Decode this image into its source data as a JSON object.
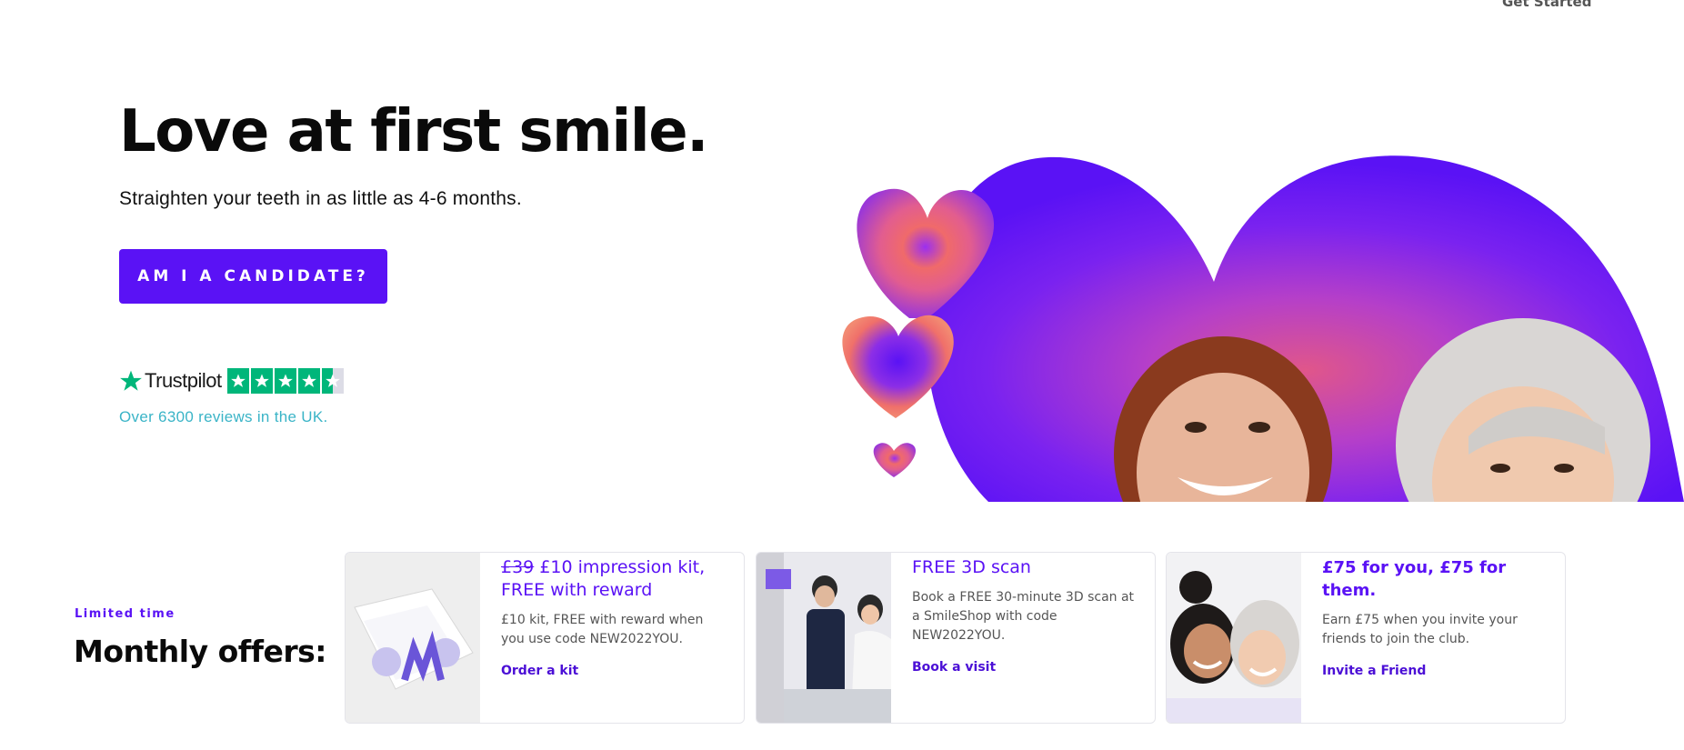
{
  "nav": {
    "get_started": "Get Started"
  },
  "hero": {
    "title": "Love at first smile.",
    "subtitle": "Straighten your teeth in as little as 4-6 months.",
    "cta": "AM I A CANDIDATE?"
  },
  "trustpilot": {
    "brand": "Trustpilot",
    "rating_stars": 4.5,
    "caption": "Over 6300 reviews in the UK."
  },
  "offers": {
    "eyebrow": "Limited time",
    "heading": "Monthly offers:",
    "cards": [
      {
        "old_price": "£39",
        "title": "£10 impression kit, FREE with reward",
        "description": "£10 kit, FREE with reward when you use code NEW2022YOU.",
        "link": "Order a kit",
        "image_icon": "impression-kit-box"
      },
      {
        "title": "FREE 3D scan",
        "description": "Book a FREE 30-minute 3D scan at a SmileShop with code NEW2022YOU.",
        "link": "Book a visit",
        "image_icon": "dentist-scanning-patient"
      },
      {
        "title": "£75 for you, £75 for them.",
        "description": "Earn £75 when you invite your friends to join the club.",
        "link": "Invite a Friend",
        "image_icon": "two-friends-smiling"
      }
    ]
  },
  "colors": {
    "brand_purple": "#5a12f5",
    "trustpilot_green": "#00b67a",
    "caption_teal": "#3ab4c7"
  }
}
